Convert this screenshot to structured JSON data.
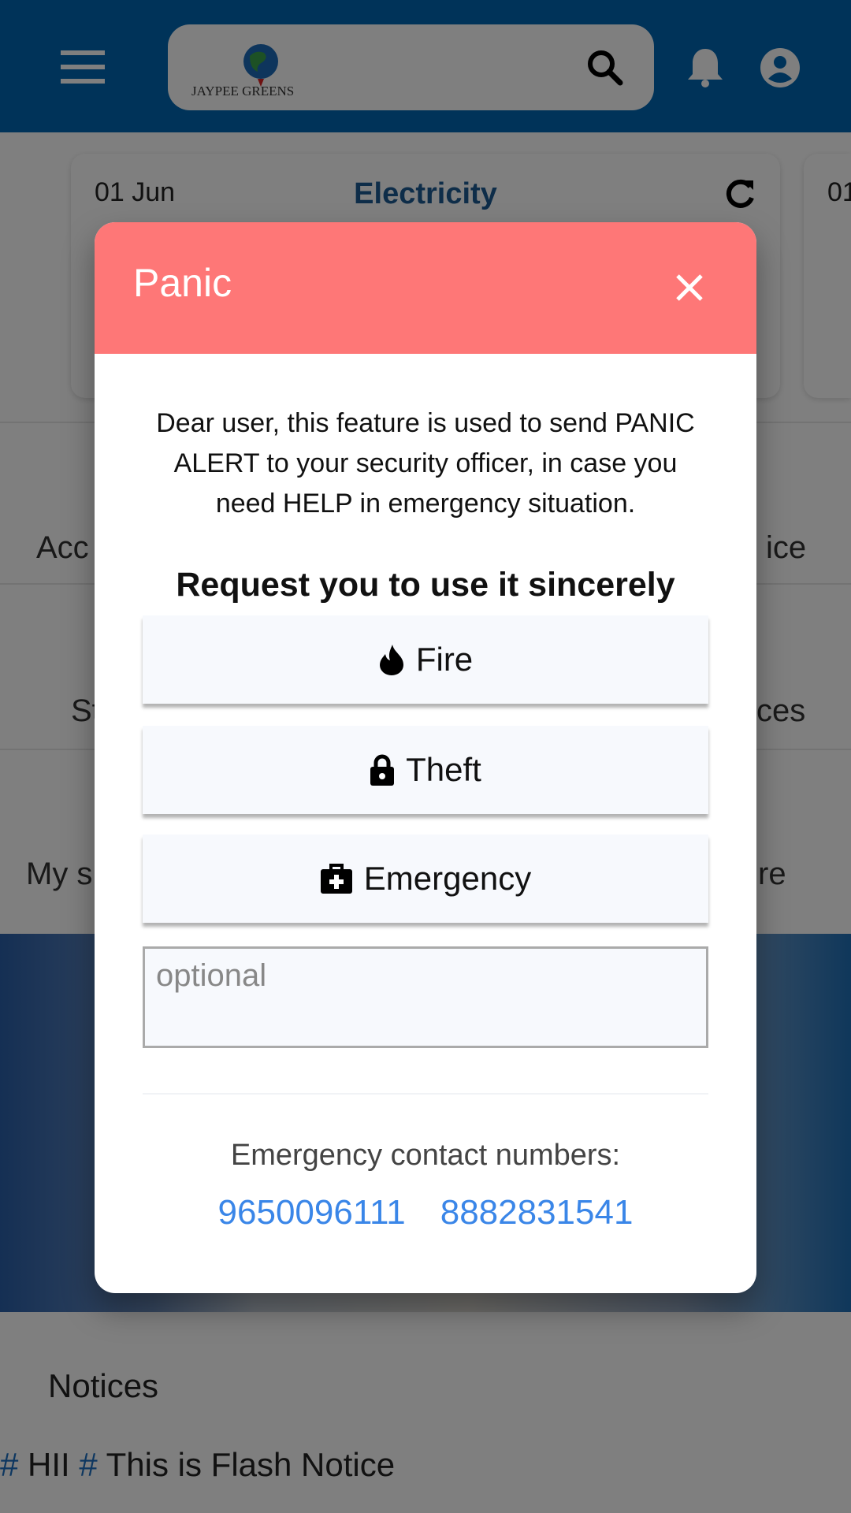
{
  "header": {
    "logo_text": "JAYPEE GREENS",
    "icons": [
      "menu-icon",
      "search-icon",
      "bell-icon",
      "account-icon"
    ],
    "color": "#0066b3"
  },
  "background": {
    "card": {
      "date": "01 Jun",
      "title": "Electricity",
      "next_card_date": "01"
    },
    "menu_fragments": [
      "Acc",
      "ice",
      "St",
      "ces",
      "My s",
      "re"
    ],
    "notices_title": "Notices",
    "flash_notice": {
      "tag1": "#",
      "text1": " HII ",
      "tag2": "#",
      "text2": " This is Flash Notice"
    }
  },
  "modal": {
    "title": "Panic",
    "header_color": "#fe7777",
    "description": "Dear user, this feature is used to send PANIC ALERT to your security officer, in case you need HELP in emergency situation.",
    "request": "Request you to use it sincerely",
    "buttons": [
      {
        "label": "Fire",
        "icon": "fire-icon"
      },
      {
        "label": "Theft",
        "icon": "lock-icon"
      },
      {
        "label": "Emergency",
        "icon": "first-aid-kit-icon"
      }
    ],
    "note_placeholder": "optional",
    "contacts_title": "Emergency contact numbers:",
    "contacts": [
      "9650096111",
      "8882831541"
    ],
    "link_color": "#3a86e8"
  }
}
